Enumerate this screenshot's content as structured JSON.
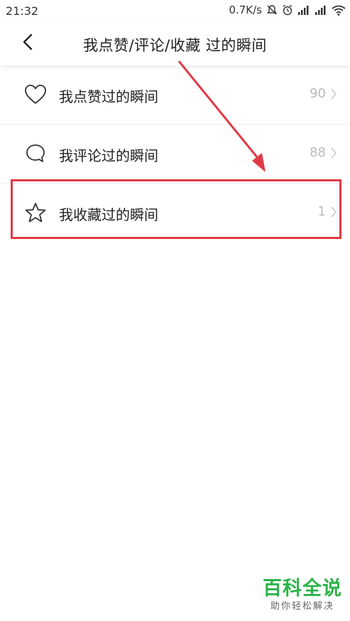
{
  "status_bar": {
    "time": "21:32",
    "network_speed": "0.7K/s",
    "icons": [
      "mute-icon",
      "alarm-icon",
      "signal-icon",
      "signal-icon",
      "wifi-icon"
    ]
  },
  "header": {
    "back_icon": "chevron-left-icon",
    "title": "我点赞/评论/收藏 过的瞬间"
  },
  "list": {
    "items": [
      {
        "icon": "heart-icon",
        "label": "我点赞过的瞬间",
        "count": "90"
      },
      {
        "icon": "speech-bubble-icon",
        "label": "我评论过的瞬间",
        "count": "88"
      },
      {
        "icon": "star-icon",
        "label": "我收藏过的瞬间",
        "count": "1"
      }
    ]
  },
  "annotation": {
    "highlight_color": "#e03a45"
  },
  "watermark": {
    "title": "百科全说",
    "subtitle": "助你轻松解决",
    "color": "#2db34a"
  }
}
